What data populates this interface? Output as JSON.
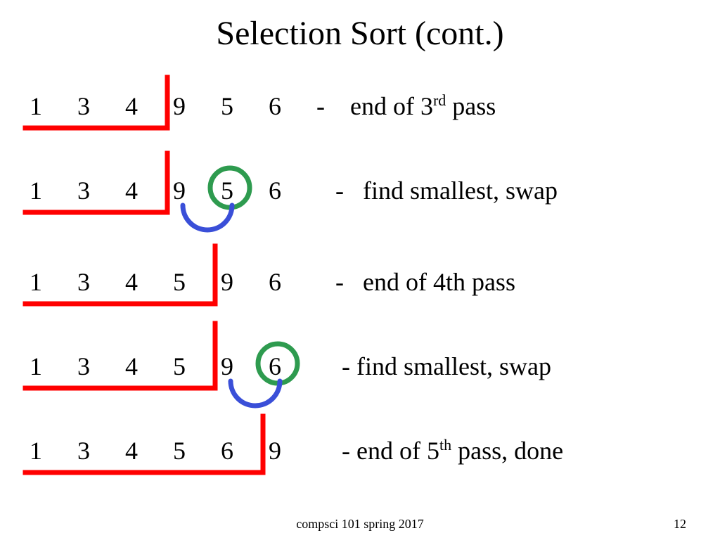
{
  "title": "Selection Sort (cont.)",
  "rows": [
    {
      "values": [
        "1",
        "3",
        "4",
        "9",
        "5",
        "6"
      ],
      "caption_prefix": "-    end of 3",
      "caption_sup": "rd",
      "caption_suffix": " pass"
    },
    {
      "values": [
        "1",
        "3",
        "4",
        "9",
        "5",
        "6"
      ],
      "caption_prefix": "   -   find smallest, swap",
      "caption_sup": "",
      "caption_suffix": ""
    },
    {
      "values": [
        "1",
        "3",
        "4",
        "5",
        "9",
        "6"
      ],
      "caption_prefix": "   -   end of 4th pass",
      "caption_sup": "",
      "caption_suffix": ""
    },
    {
      "values": [
        "1",
        "3",
        "4",
        "5",
        "9",
        "6"
      ],
      "caption_prefix": "    - find smallest, swap",
      "caption_sup": "",
      "caption_suffix": ""
    },
    {
      "values": [
        "1",
        "3",
        "4",
        "5",
        "6",
        "9"
      ],
      "caption_prefix": "    - end of 5",
      "caption_sup": "th",
      "caption_suffix": " pass, done"
    }
  ],
  "row_tops": [
    130,
    250,
    380,
    500,
    620
  ],
  "footer": {
    "course": "compsci 101 spring 2017",
    "page": "12"
  },
  "colors": {
    "bracket": "#ff0000",
    "circle": "#2e9b4f",
    "arc": "#3a4fd8"
  }
}
